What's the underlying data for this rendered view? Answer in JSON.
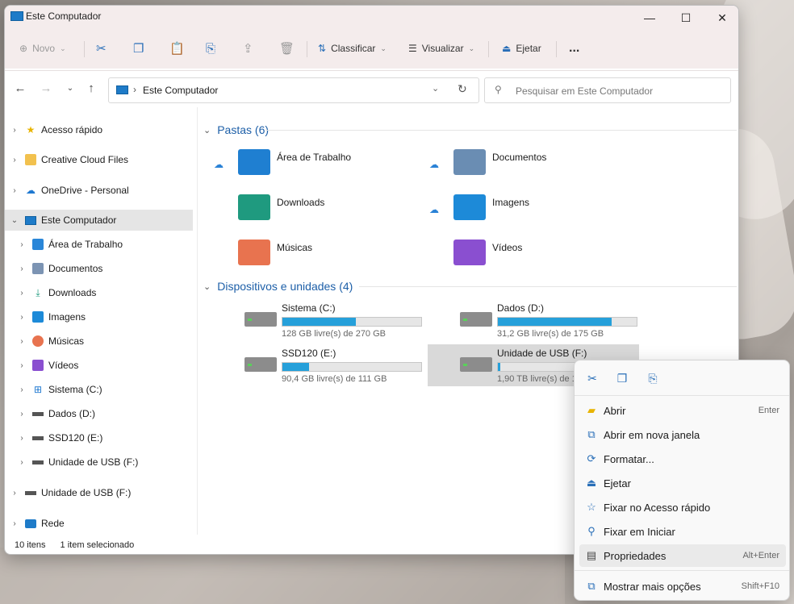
{
  "window": {
    "title": "Este Computador"
  },
  "toolbar": {
    "new": "Novo",
    "sort": "Classificar",
    "view": "Visualizar",
    "eject": "Ejetar",
    "more": "..."
  },
  "address": {
    "location": "Este Computador",
    "search_placeholder": "Pesquisar em Este Computador"
  },
  "sidebar": {
    "items": [
      {
        "label": "Acesso rápido"
      },
      {
        "label": "Creative Cloud Files"
      },
      {
        "label": "OneDrive - Personal"
      },
      {
        "label": "Este Computador"
      },
      {
        "label": "Área de Trabalho"
      },
      {
        "label": "Documentos"
      },
      {
        "label": "Downloads"
      },
      {
        "label": "Imagens"
      },
      {
        "label": "Músicas"
      },
      {
        "label": "Vídeos"
      },
      {
        "label": "Sistema (C:)"
      },
      {
        "label": "Dados (D:)"
      },
      {
        "label": "SSD120 (E:)"
      },
      {
        "label": "Unidade de USB (F:)"
      },
      {
        "label": "Unidade de USB (F:)"
      },
      {
        "label": "Rede"
      }
    ]
  },
  "content": {
    "folders_header": "Pastas (6)",
    "folders": [
      {
        "name": "Área de Trabalho",
        "color": "#1f7fd1"
      },
      {
        "name": "Documentos",
        "color": "#6a8db3"
      },
      {
        "name": "Downloads",
        "color": "#1f9a7f"
      },
      {
        "name": "Imagens",
        "color": "#1d8ad8"
      },
      {
        "name": "Músicas",
        "color": "#e8734f"
      },
      {
        "name": "Vídeos",
        "color": "#8a4fd0"
      }
    ],
    "drives_header": "Dispositivos e unidades (4)",
    "drives": [
      {
        "name": "Sistema (C:)",
        "free": "128 GB livre(s) de 270 GB",
        "used_fraction": 0.53
      },
      {
        "name": "Dados (D:)",
        "free": "31,2 GB livre(s) de 175 GB",
        "used_fraction": 0.82
      },
      {
        "name": "SSD120 (E:)",
        "free": "90,4 GB livre(s) de 111 GB",
        "used_fraction": 0.19
      },
      {
        "name": "Unidade de USB (F:)",
        "free": "1,90 TB livre(s) de 1,9",
        "used_fraction": 0.02
      }
    ]
  },
  "status": {
    "count": "10 itens",
    "selection": "1 item selecionado"
  },
  "context_menu": {
    "items": [
      {
        "label": "Abrir",
        "shortcut": "Enter"
      },
      {
        "label": "Abrir em nova janela",
        "shortcut": ""
      },
      {
        "label": "Formatar...",
        "shortcut": ""
      },
      {
        "label": "Ejetar",
        "shortcut": ""
      },
      {
        "label": "Fixar no Acesso rápido",
        "shortcut": ""
      },
      {
        "label": "Fixar em Iniciar",
        "shortcut": ""
      },
      {
        "label": "Propriedades",
        "shortcut": "Alt+Enter"
      },
      {
        "label": "Mostrar mais opções",
        "shortcut": "Shift+F10"
      }
    ]
  }
}
